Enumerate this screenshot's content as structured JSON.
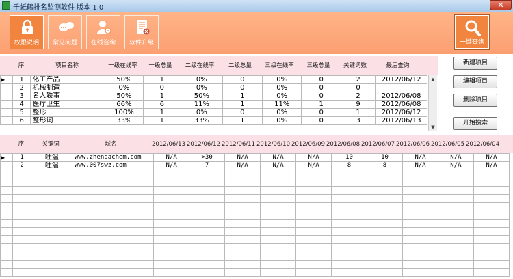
{
  "window": {
    "title": "千紙鶴排名监测软件 版本 1.0",
    "close_glyph": "✕"
  },
  "toolbar": {
    "buttons": [
      {
        "label": "权限说明",
        "icon": "lock-icon"
      },
      {
        "label": "常见问题",
        "icon": "chat-bubbles-icon"
      },
      {
        "label": "在线咨询",
        "icon": "user-support-icon"
      },
      {
        "label": "软件升级",
        "icon": "document-upgrade-icon"
      }
    ],
    "query": {
      "label": "一键查询",
      "icon": "magnifier-icon"
    }
  },
  "projects": {
    "columns": [
      "序",
      "项目名称",
      "一级在线率",
      "一级总量",
      "二级在线率",
      "二级总量",
      "三级在线率",
      "三级总量",
      "关键词数",
      "最后查询"
    ],
    "rows": [
      [
        "1",
        "化工产品",
        "50%",
        "1",
        "0%",
        "0",
        "0%",
        "0",
        "2",
        "2012/06/12"
      ],
      [
        "2",
        "机械制造",
        "0%",
        "0",
        "0%",
        "0",
        "0%",
        "0",
        "0",
        ""
      ],
      [
        "3",
        "名人轶事",
        "50%",
        "1",
        "50%",
        "1",
        "0%",
        "0",
        "2",
        "2012/06/08"
      ],
      [
        "4",
        "医疗卫生",
        "66%",
        "6",
        "11%",
        "1",
        "11%",
        "1",
        "9",
        "2012/06/08"
      ],
      [
        "5",
        "整形",
        "100%",
        "1",
        "0%",
        "0",
        "0%",
        "0",
        "1",
        "2012/06/12"
      ],
      [
        "6",
        "整形词",
        "33%",
        "1",
        "33%",
        "1",
        "0%",
        "0",
        "3",
        "2012/06/13"
      ]
    ],
    "selected_marker": "▶"
  },
  "side_buttons": {
    "new": "新建项目",
    "edit": "编辑项目",
    "delete": "删除项目",
    "search": "开始搜索"
  },
  "keywords": {
    "columns": [
      "序",
      "关键词",
      "域名",
      "2012/06/13",
      "2012/06/12",
      "2012/06/11",
      "2012/06/10",
      "2012/06/09",
      "2012/06/08",
      "2012/06/07",
      "2012/06/06",
      "2012/06/05",
      "2012/06/04"
    ],
    "rows": [
      [
        "1",
        "吐温",
        "www.zhendachem.com",
        "N/A",
        ">30",
        "N/A",
        "N/A",
        "N/A",
        "10",
        "10",
        "N/A",
        "N/A",
        "N/A"
      ],
      [
        "2",
        "吐温",
        "www.007swz.com",
        "N/A",
        "7",
        "N/A",
        "N/A",
        "N/A",
        "8",
        "8",
        "N/A",
        "N/A",
        "N/A"
      ]
    ],
    "selected_marker": "▶"
  },
  "colors": {
    "toolbar": "#fb9f72",
    "header_band": "#fbe0e5",
    "active_button": "#f1843f"
  }
}
